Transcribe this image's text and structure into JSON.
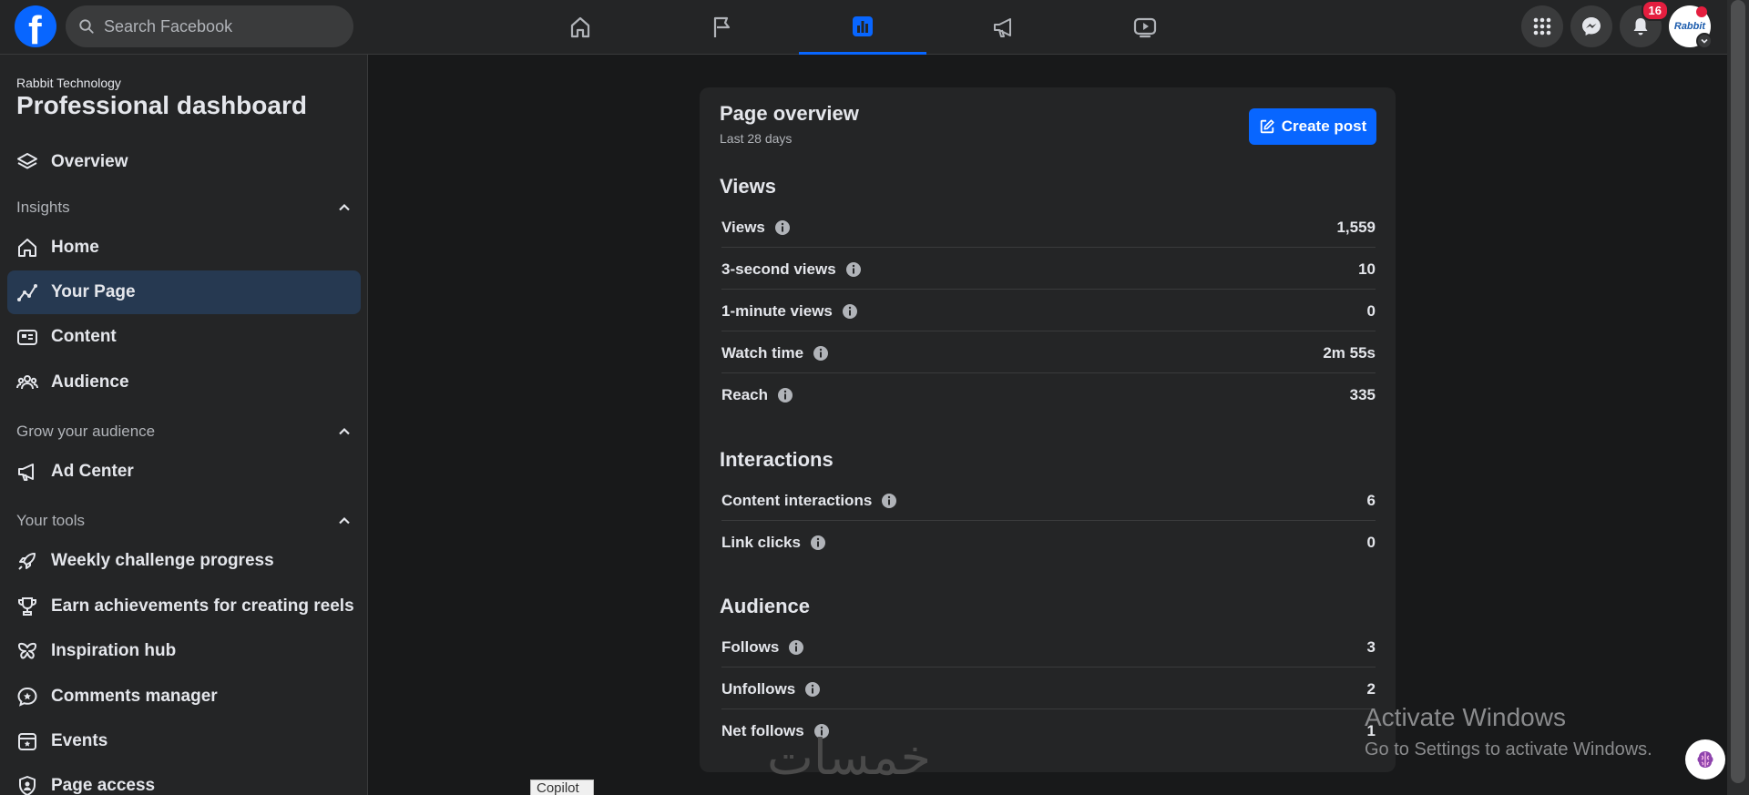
{
  "topbar": {
    "logo": "f",
    "search_placeholder": "Search Facebook",
    "notifications_count": "16",
    "avatar_text": "Rabbit"
  },
  "sidebar": {
    "page_name": "Rabbit Technology",
    "title": "Professional dashboard",
    "overview": "Overview",
    "sections": {
      "insights": "Insights",
      "grow": "Grow your audience",
      "tools": "Your tools"
    },
    "items": {
      "home": "Home",
      "your_page": "Your Page",
      "content": "Content",
      "audience": "Audience",
      "ad_center": "Ad Center",
      "weekly": "Weekly challenge progress",
      "achievements": "Earn achievements for creating reels",
      "inspiration": "Inspiration hub",
      "comments": "Comments manager",
      "events": "Events",
      "page_access": "Page access"
    }
  },
  "main": {
    "title": "Page overview",
    "subtitle": "Last 28 days",
    "create_post": "Create post",
    "views_title": "Views",
    "interactions_title": "Interactions",
    "audience_title": "Audience",
    "views": [
      {
        "name": "Views",
        "value": "1,559"
      },
      {
        "name": "3-second views",
        "value": "10"
      },
      {
        "name": "1-minute views",
        "value": "0"
      },
      {
        "name": "Watch time",
        "value": "2m 55s"
      },
      {
        "name": "Reach",
        "value": "335"
      }
    ],
    "interactions": [
      {
        "name": "Content interactions",
        "value": "6"
      },
      {
        "name": "Link clicks",
        "value": "0"
      }
    ],
    "audience": [
      {
        "name": "Follows",
        "value": "3"
      },
      {
        "name": "Unfollows",
        "value": "2"
      },
      {
        "name": "Net follows",
        "value": "1"
      }
    ]
  },
  "overlay": {
    "windows_title": "Activate Windows",
    "windows_sub": "Go to Settings to activate Windows.",
    "copilot": "Copilot",
    "watermark": "خمسات"
  },
  "colors": {
    "accent": "#0866ff",
    "background": "#18191a",
    "surface": "#242526",
    "active_item": "#263951",
    "badge": "#e41e3f"
  }
}
